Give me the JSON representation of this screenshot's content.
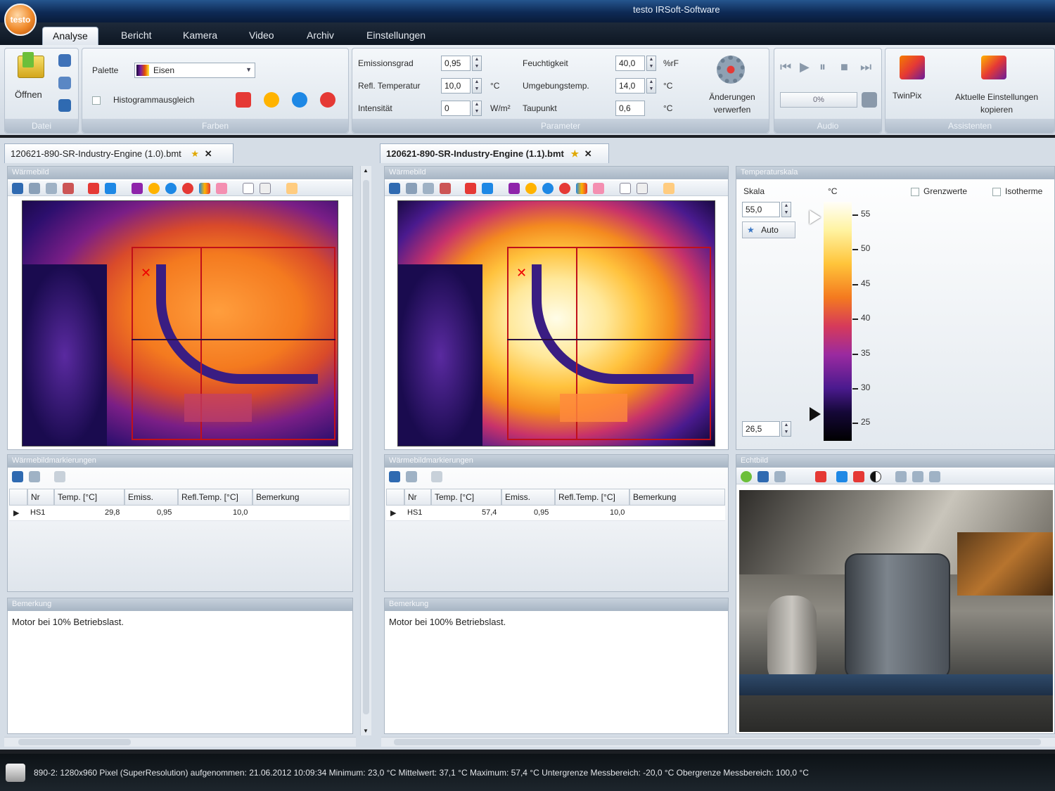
{
  "app": {
    "title": "testo IRSoft-Software",
    "logo_text": "testo"
  },
  "main_tabs": [
    {
      "label": "Analyse",
      "active": true
    },
    {
      "label": "Bericht"
    },
    {
      "label": "Kamera"
    },
    {
      "label": "Video"
    },
    {
      "label": "Archiv"
    },
    {
      "label": "Einstellungen"
    }
  ],
  "ribbon": {
    "datei": {
      "group_label": "Datei",
      "open_label": "Öffnen"
    },
    "farben": {
      "group_label": "Farben",
      "palette_label": "Palette",
      "palette_value": "Eisen",
      "histogram_label": "Histogrammausgleich"
    },
    "parameter": {
      "group_label": "Parameter",
      "emission_label": "Emissionsgrad",
      "emission_value": "0,95",
      "refl_label": "Refl. Temperatur",
      "refl_value": "10,0",
      "refl_unit": "°C",
      "intensity_label": "Intensität",
      "intensity_value": "0",
      "intensity_unit": "W/m²",
      "humidity_label": "Feuchtigkeit",
      "humidity_value": "40,0",
      "humidity_unit": "%rF",
      "ambient_label": "Umgebungstemp.",
      "ambient_value": "14,0",
      "ambient_unit": "°C",
      "dew_label": "Taupunkt",
      "dew_value": "0,6",
      "dew_unit": "°C",
      "discard_label": "Änderungen verwerfen"
    },
    "audio": {
      "group_label": "Audio",
      "progress_label": "0%"
    },
    "assistenten": {
      "group_label": "Assistenten",
      "twinpix_label": "TwinPix",
      "copy_label": "Aktuelle Einstellungen kopieren"
    }
  },
  "doc_tabs": [
    {
      "label": "120621-890-SR-Industry-Engine (1.0).bmt"
    },
    {
      "label": "120621-890-SR-Industry-Engine (1.1).bmt"
    }
  ],
  "left": {
    "image_header": "Wärmebild",
    "markers_header": "Wärmebildmarkierungen",
    "remark_header": "Bemerkung",
    "columns": [
      "Nr",
      "Temp. [°C]",
      "Emiss.",
      "Refl.Temp. [°C]",
      "Bemerkung"
    ],
    "rows": [
      {
        "nr": "HS1",
        "temp": "29,8",
        "emiss": "0,95",
        "refl": "10,0"
      }
    ],
    "remark_text": "Motor bei 10% Betriebslast."
  },
  "right": {
    "image_header": "Wärmebild",
    "markers_header": "Wärmebildmarkierungen",
    "remark_header": "Bemerkung",
    "columns": [
      "Nr",
      "Temp. [°C]",
      "Emiss.",
      "Refl.Temp. [°C]",
      "Bemerkung"
    ],
    "rows": [
      {
        "nr": "HS1",
        "temp": "57,4",
        "emiss": "0,95",
        "refl": "10,0"
      }
    ],
    "remark_text": "Motor bei 100% Betriebslast."
  },
  "scale_panel": {
    "header": "Temperaturskala",
    "scale_label": "Skala",
    "unit": "°C",
    "max_value": "55,0",
    "min_value": "26,5",
    "auto_label": "Auto",
    "limit_label": "Grenzwerte",
    "isotherm_label": "Isotherme",
    "ticks": [
      "55",
      "50",
      "45",
      "40",
      "35",
      "30",
      "25"
    ]
  },
  "real_image": {
    "header": "Echtbild"
  },
  "status": {
    "text": "890-2: 1280x960 Pixel (SuperResolution) aufgenommen: 21.06.2012 10:09:34   Minimum: 23,0 °C   Mittelwert: 37,1 °C   Maximum: 57,4 °C   Untergrenze Messbereich: -20,0 °C   Obergrenze Messbereich: 100,0 °C"
  },
  "colors": {
    "accent": "#0e2a55",
    "ribbon": "#dbe3eb",
    "status_bg": "#1d252c"
  }
}
